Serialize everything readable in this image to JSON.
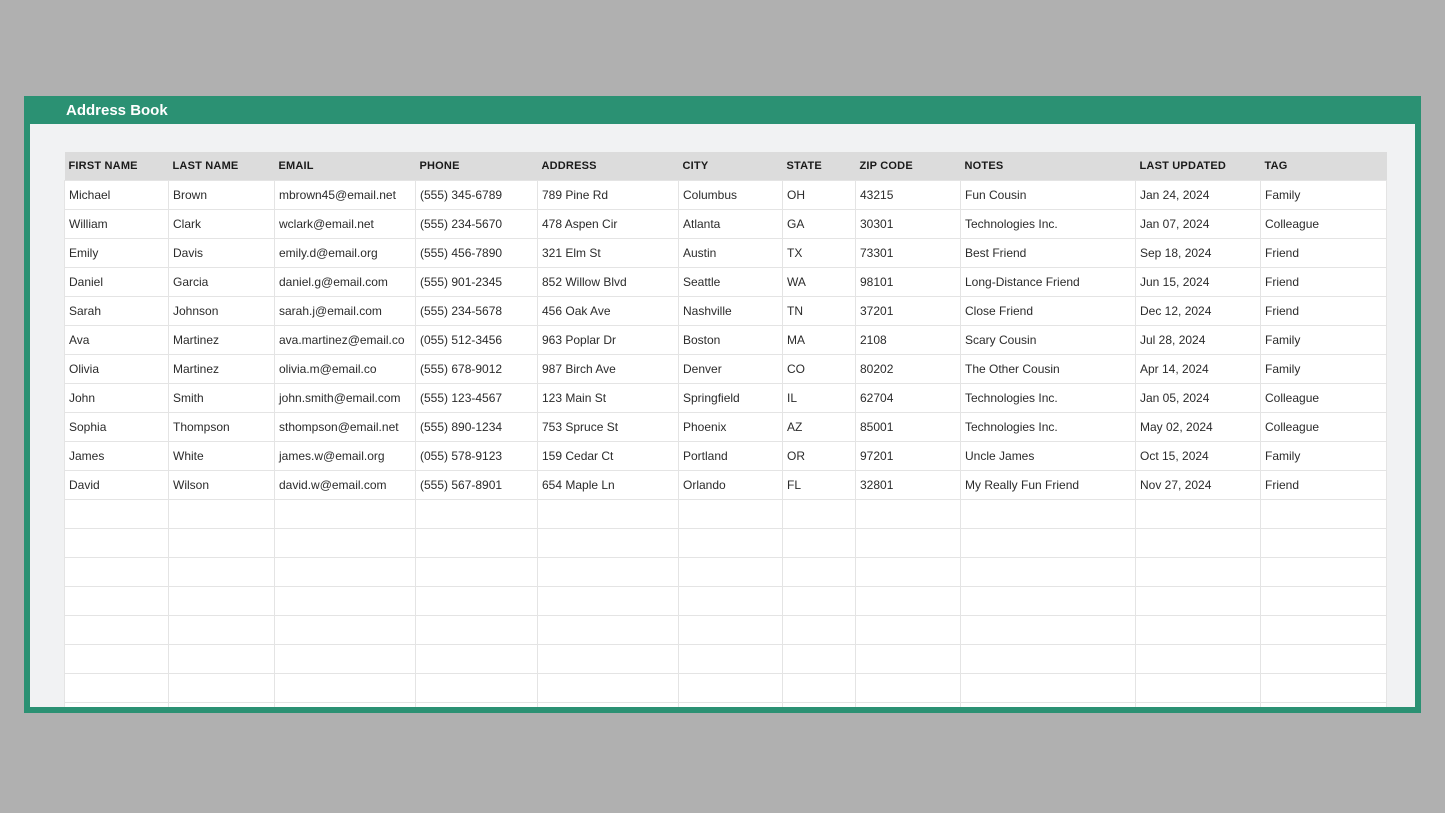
{
  "title": "Address Book",
  "columns": [
    "FIRST NAME",
    "LAST NAME",
    "EMAIL",
    "PHONE",
    "ADDRESS",
    "CITY",
    "STATE",
    "ZIP CODE",
    "NOTES",
    "LAST UPDATED",
    "TAG"
  ],
  "rows": [
    {
      "first": "Michael",
      "last": "Brown",
      "email": "mbrown45@email.net",
      "phone": "(555) 345-6789",
      "address": "789 Pine Rd",
      "city": "Columbus",
      "state": "OH",
      "zip": "43215",
      "notes": "Fun Cousin",
      "updated": "Jan 24, 2024",
      "tag": "Family"
    },
    {
      "first": "William",
      "last": "Clark",
      "email": "wclark@email.net",
      "phone": "(555) 234-5670",
      "address": "478 Aspen Cir",
      "city": "Atlanta",
      "state": "GA",
      "zip": "30301",
      "notes": "Technologies Inc.",
      "updated": "Jan 07, 2024",
      "tag": "Colleague"
    },
    {
      "first": "Emily",
      "last": "Davis",
      "email": "emily.d@email.org",
      "phone": "(555) 456-7890",
      "address": "321 Elm St",
      "city": "Austin",
      "state": "TX",
      "zip": "73301",
      "notes": "Best Friend",
      "updated": "Sep 18, 2024",
      "tag": "Friend"
    },
    {
      "first": "Daniel",
      "last": "Garcia",
      "email": "daniel.g@email.com",
      "phone": "(555) 901-2345",
      "address": "852 Willow Blvd",
      "city": "Seattle",
      "state": "WA",
      "zip": "98101",
      "notes": "Long-Distance Friend",
      "updated": "Jun 15, 2024",
      "tag": "Friend"
    },
    {
      "first": "Sarah",
      "last": "Johnson",
      "email": "sarah.j@email.com",
      "phone": "(555) 234-5678",
      "address": "456 Oak Ave",
      "city": "Nashville",
      "state": "TN",
      "zip": "37201",
      "notes": "Close Friend",
      "updated": "Dec 12, 2024",
      "tag": "Friend"
    },
    {
      "first": "Ava",
      "last": "Martinez",
      "email": "ava.martinez@email.co",
      "phone": "(055) 512-3456",
      "address": "963 Poplar Dr",
      "city": "Boston",
      "state": "MA",
      "zip": "2108",
      "notes": "Scary Cousin",
      "updated": "Jul 28, 2024",
      "tag": "Family"
    },
    {
      "first": "Olivia",
      "last": "Martinez",
      "email": "olivia.m@email.co",
      "phone": "(555) 678-9012",
      "address": "987 Birch Ave",
      "city": "Denver",
      "state": "CO",
      "zip": "80202",
      "notes": "The Other Cousin",
      "updated": "Apr 14, 2024",
      "tag": "Family"
    },
    {
      "first": "John",
      "last": "Smith",
      "email": "john.smith@email.com",
      "phone": "(555) 123-4567",
      "address": "123 Main St",
      "city": "Springfield",
      "state": "IL",
      "zip": "62704",
      "notes": "Technologies Inc.",
      "updated": "Jan 05, 2024",
      "tag": "Colleague"
    },
    {
      "first": "Sophia",
      "last": "Thompson",
      "email": "sthompson@email.net",
      "phone": "(555) 890-1234",
      "address": "753 Spruce St",
      "city": "Phoenix",
      "state": "AZ",
      "zip": "85001",
      "notes": "Technologies Inc.",
      "updated": "May 02, 2024",
      "tag": "Colleague"
    },
    {
      "first": "James",
      "last": "White",
      "email": "james.w@email.org",
      "phone": "(055) 578-9123",
      "address": "159 Cedar Ct",
      "city": "Portland",
      "state": "OR",
      "zip": "97201",
      "notes": "Uncle James",
      "updated": "Oct 15, 2024",
      "tag": "Family"
    },
    {
      "first": "David",
      "last": "Wilson",
      "email": "david.w@email.com",
      "phone": "(555) 567-8901",
      "address": "654 Maple Ln",
      "city": "Orlando",
      "state": "FL",
      "zip": "32801",
      "notes": "My Really Fun Friend",
      "updated": "Nov 27, 2024",
      "tag": "Friend"
    }
  ],
  "empty_rows": 8
}
